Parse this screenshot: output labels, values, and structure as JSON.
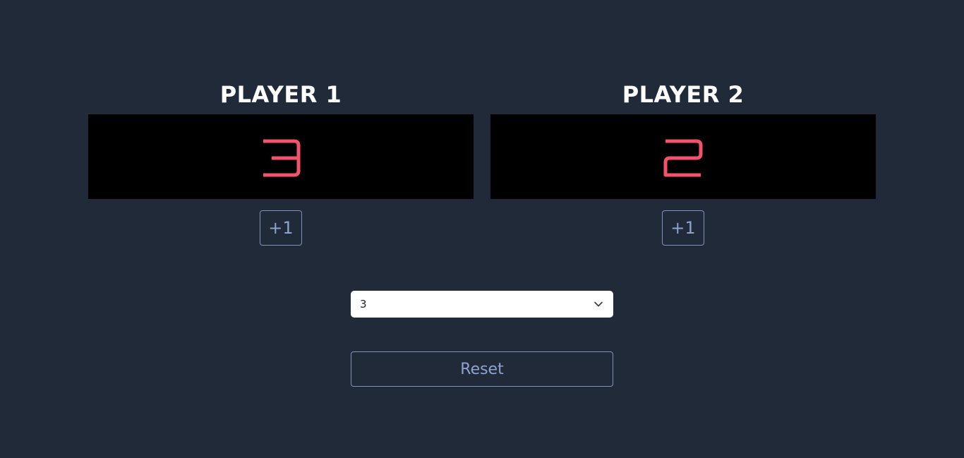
{
  "players": [
    {
      "title": "PLAYER 1",
      "score": "3",
      "button_label": "+1"
    },
    {
      "title": "PLAYER 2",
      "score": "2",
      "button_label": "+1"
    }
  ],
  "goal_select": {
    "selected_value": "3",
    "icon": "chevron-down-icon"
  },
  "reset_label": "Reset",
  "colors": {
    "background": "#212a39",
    "score_panel": "#000000",
    "score_digit": "#f4516c",
    "button_text": "#8fa3cf",
    "button_border": "#8193b8",
    "title_text": "#ffffff"
  }
}
